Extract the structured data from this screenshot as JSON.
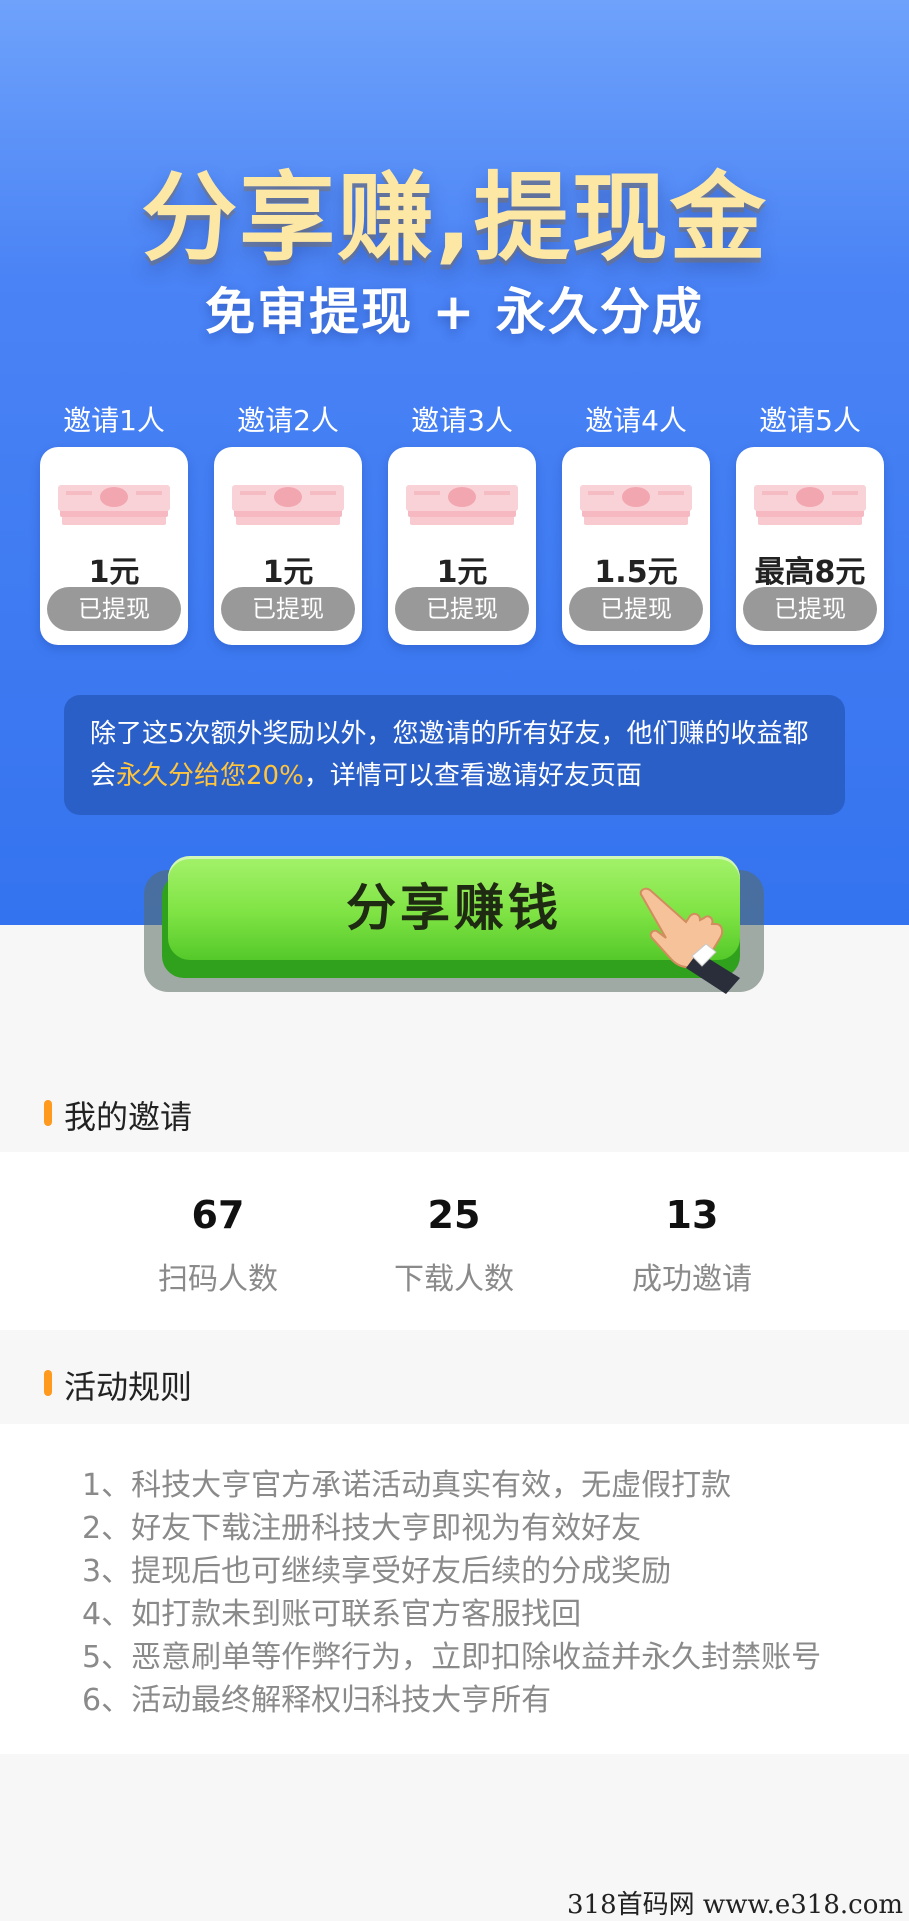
{
  "hero": {
    "title": "分享赚,提现金",
    "subtitle": "免审提现 + 永久分成"
  },
  "tiers": [
    {
      "label": "邀请1人",
      "amount": "1元",
      "status": "已提现"
    },
    {
      "label": "邀请2人",
      "amount": "1元",
      "status": "已提现"
    },
    {
      "label": "邀请3人",
      "amount": "1元",
      "status": "已提现"
    },
    {
      "label": "邀请4人",
      "amount": "1.5元",
      "status": "已提现"
    },
    {
      "label": "邀请5人",
      "amount": "最高8元",
      "status": "已提现"
    }
  ],
  "info": {
    "text_before": "除了这5次额外奖励以外，您邀请的所有好友，他们赚的收益都会",
    "highlight": "永久分给您20%",
    "text_after": "，详情可以查看邀请好友页面",
    "highlight_color": "#ffc53d"
  },
  "cta": {
    "label": "分享赚钱"
  },
  "my_invites": {
    "title": "我的邀请",
    "stats": [
      {
        "value": "67",
        "label": "扫码人数"
      },
      {
        "value": "25",
        "label": "下载人数"
      },
      {
        "value": "13",
        "label": "成功邀请"
      }
    ]
  },
  "rules": {
    "title": "活动规则",
    "items": [
      "1、科技大亨官方承诺活动真实有效，无虚假打款",
      "2、好友下载注册科技大亨即视为有效好友",
      "3、提现后也可继续享受好友后续的分成奖励",
      "4、如打款未到账可联系官方客服找回",
      "5、恶意刷单等作弊行为，立即扣除收益并永久封禁账号",
      "6、活动最终解释权归科技大亨所有"
    ]
  },
  "watermark": "318首码网 www.e318.com",
  "colors": {
    "hero_blue": "#3473ef",
    "accent_orange": "#ff9a1f",
    "cta_green": "#7fe344",
    "status_gray": "#999999"
  },
  "icons": [
    "money-stack-icon",
    "pointing-hand-icon",
    "section-marker-icon"
  ]
}
